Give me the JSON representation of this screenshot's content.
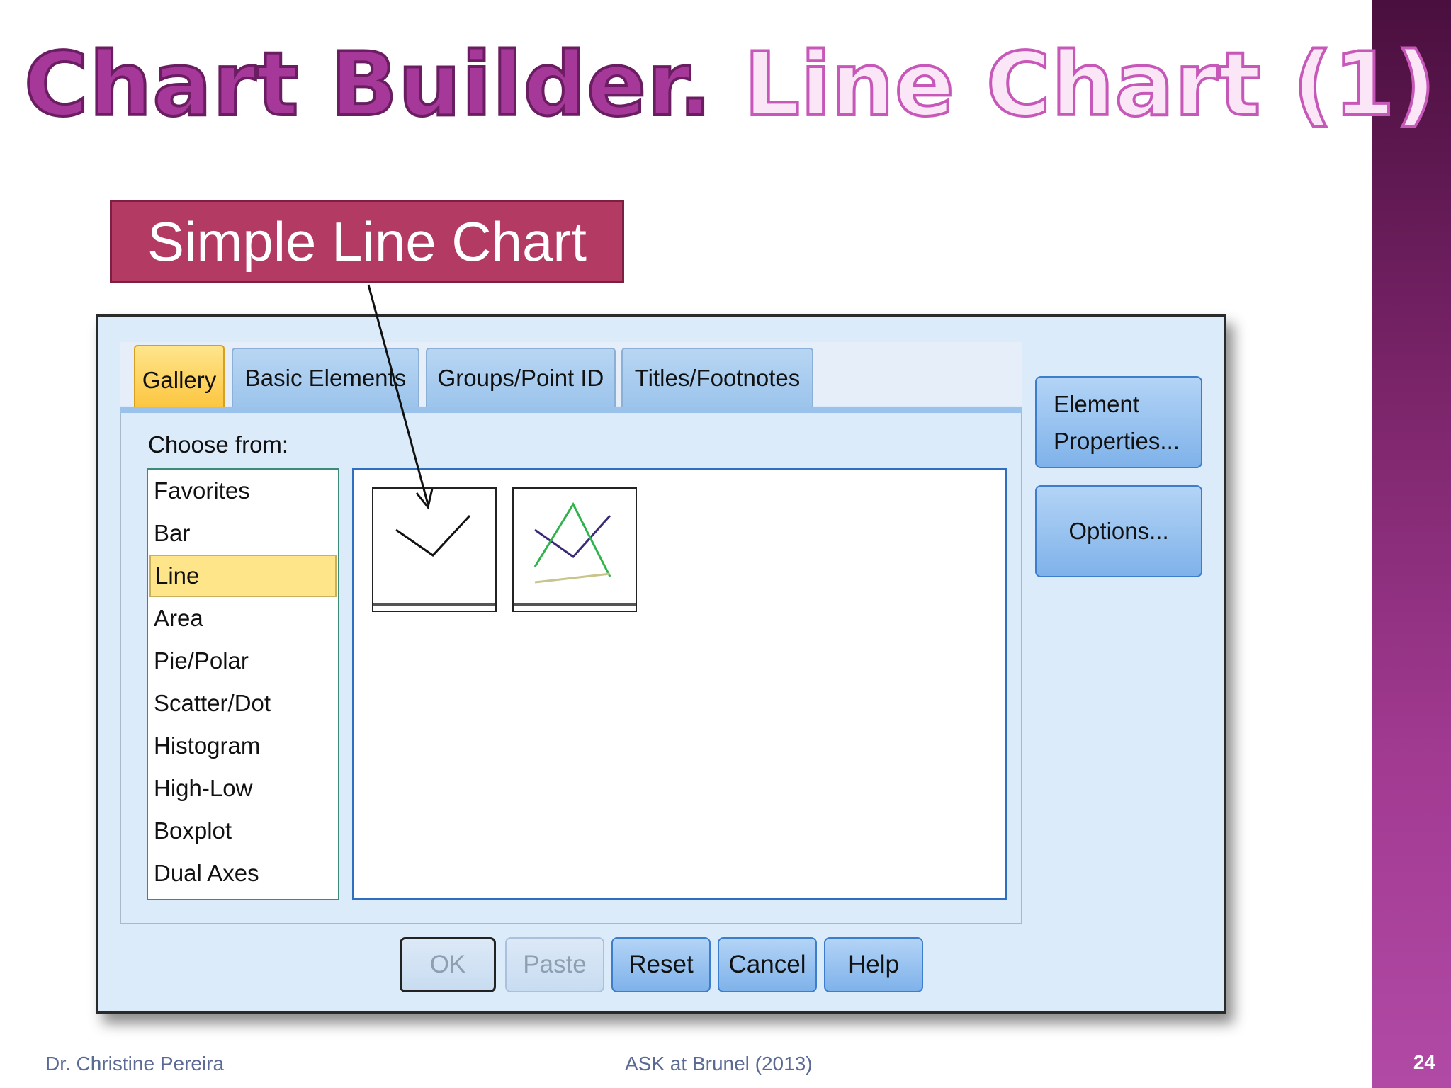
{
  "slide": {
    "title_part1": "Chart Builder.",
    "title_part2": "Line Chart (1)",
    "callout": "Simple Line Chart",
    "footer_left": "Dr. Christine Pereira",
    "footer_center": "ASK at Brunel (2013)",
    "page_number": "24"
  },
  "dialog": {
    "tabs": [
      {
        "label": "Gallery",
        "active": true
      },
      {
        "label": "Basic Elements",
        "active": false
      },
      {
        "label": "Groups/Point ID",
        "active": false
      },
      {
        "label": "Titles/Footnotes",
        "active": false
      }
    ],
    "choose_label": "Choose from:",
    "chart_types": [
      "Favorites",
      "Bar",
      "Line",
      "Area",
      "Pie/Polar",
      "Scatter/Dot",
      "Histogram",
      "High-Low",
      "Boxplot",
      "Dual Axes"
    ],
    "selected_chart_type": "Line",
    "gallery_items": [
      "simple-line-icon",
      "multiple-line-icon"
    ],
    "side_buttons": {
      "element_properties_line1": "Element",
      "element_properties_line2": "Properties...",
      "options": "Options..."
    },
    "bottom_buttons": {
      "ok": "OK",
      "paste": "Paste",
      "reset": "Reset",
      "cancel": "Cancel",
      "help": "Help"
    }
  },
  "colors": {
    "title_main": "#a6389a",
    "callout_bg": "#b23a63",
    "tab_active": "#fcc237",
    "selection": "#fee58a",
    "dialog_bg": "#dcebf9"
  }
}
